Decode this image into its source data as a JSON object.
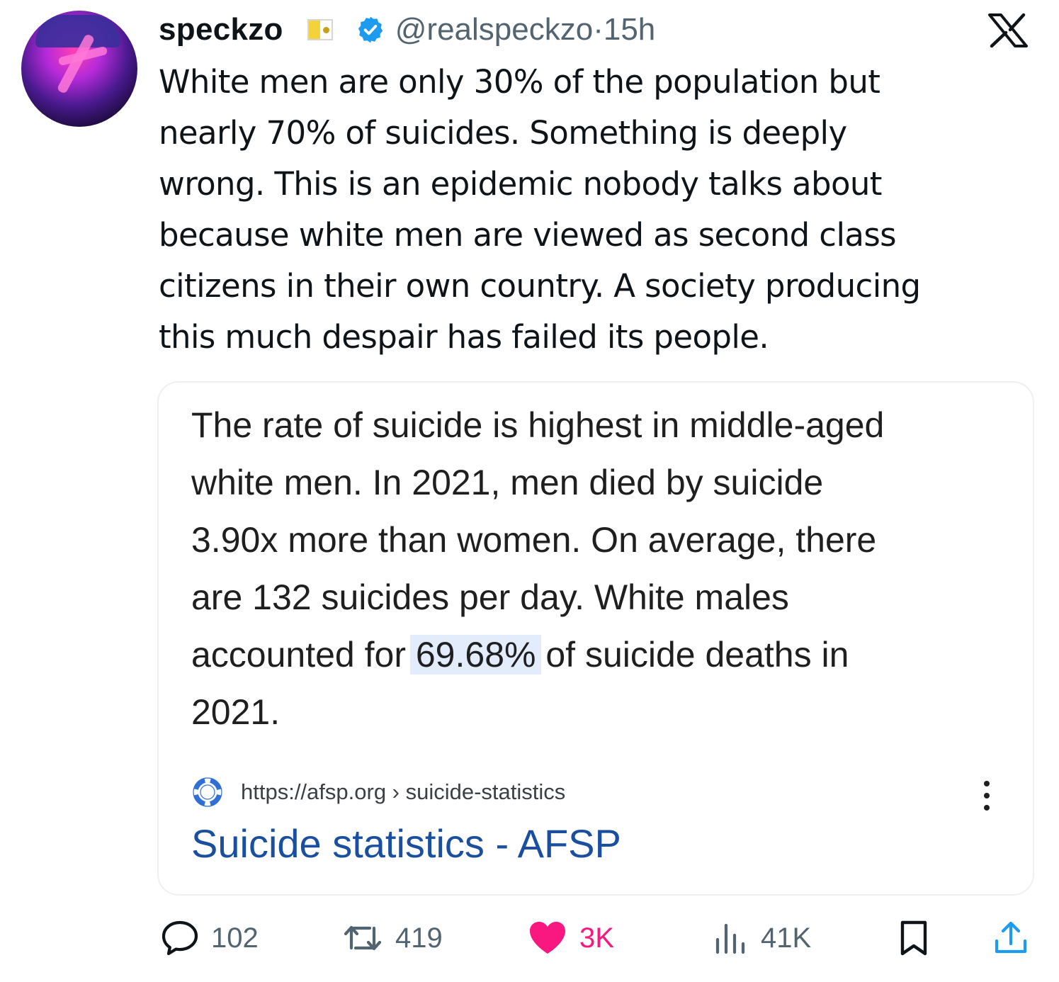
{
  "author": {
    "display_name": "speckzo",
    "handle": "@realspeckzo",
    "separator": "·",
    "time": "15h",
    "avatar_icon": "profile-avatar",
    "flag_icon": "vatican-flag-icon",
    "verified_icon": "verified-badge-icon"
  },
  "platform_icon": "x-logo-icon",
  "tweet": {
    "lines": [
      "White men are only 30% of the population but",
      "nearly 70% of suicides. Something is deeply",
      "wrong. This is an epidemic nobody talks about",
      "because white men are viewed as second class",
      "citizens in their own country. A society producing",
      "this much despair has failed its people."
    ]
  },
  "quoted_card": {
    "lines": [
      "The rate of suicide is highest in middle-aged",
      "white men. In 2021, men died by suicide",
      "3.90x more than women. On average, there",
      "are 132 suicides per day. White males"
    ],
    "line5_pre": "accounted for ",
    "line5_highlight": "69.68%",
    "line5_post": " of suicide deaths in",
    "line6": "2021.",
    "source_url": "https://afsp.org › suicide-statistics",
    "source_title": "Suicide statistics - AFSP",
    "favicon": "afsp-lifebuoy-icon",
    "menu_icon": "more-vertical-icon"
  },
  "actions": {
    "replies": "102",
    "reposts": "419",
    "likes": "3K",
    "views": "41K",
    "like_color": "#f91880",
    "muted_color": "#536471",
    "icons": [
      "reply-icon",
      "repost-icon",
      "like-icon",
      "views-icon",
      "bookmark-icon",
      "share-icon"
    ]
  },
  "colors": {
    "text": "#0f1419",
    "verified": "#1d9bf0",
    "link": "#1a4fa0",
    "highlight": "#e3ecfb"
  }
}
